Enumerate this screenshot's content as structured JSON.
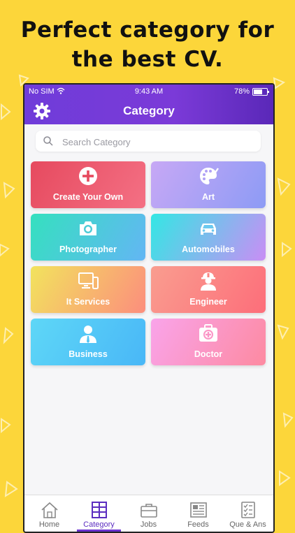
{
  "promo": {
    "line1": "Perfect category for",
    "line2": "the best CV."
  },
  "status_bar": {
    "carrier": "No SIM",
    "time": "9:43 AM",
    "battery": "78%",
    "battery_level": 0.78
  },
  "header": {
    "title": "Category",
    "settings_icon": "gear-icon"
  },
  "search": {
    "placeholder": "Search Category",
    "value": ""
  },
  "categories": [
    {
      "label": "Create Your Own",
      "icon": "plus-circle-icon",
      "colors": [
        "#e64a5f",
        "#f47084"
      ]
    },
    {
      "label": "Art",
      "icon": "palette-icon",
      "colors": [
        "#c7a8f5",
        "#8d9bf5"
      ]
    },
    {
      "label": "Photographer",
      "icon": "camera-icon",
      "colors": [
        "#35e0bf",
        "#63b6f4"
      ]
    },
    {
      "label": "Automobiles",
      "icon": "car-icon",
      "colors": [
        "#33e7e4",
        "#c98ef5"
      ]
    },
    {
      "label": "It Services",
      "icon": "computer-icon",
      "colors": [
        "#f2e35d",
        "#fc8e7d"
      ]
    },
    {
      "label": "Engineer",
      "icon": "engineer-icon",
      "colors": [
        "#f99d8f",
        "#fd6e7a"
      ]
    },
    {
      "label": "Business",
      "icon": "businessman-icon",
      "colors": [
        "#5ed7f7",
        "#49b7f7"
      ]
    },
    {
      "label": "Doctor",
      "icon": "medical-kit-icon",
      "colors": [
        "#f9a4ea",
        "#fd8aa1"
      ]
    }
  ],
  "tabs": [
    {
      "label": "Home",
      "icon": "home-icon"
    },
    {
      "label": "Category",
      "icon": "category-grid-icon",
      "active": true
    },
    {
      "label": "Jobs",
      "icon": "briefcase-icon"
    },
    {
      "label": "Feeds",
      "icon": "newspaper-icon"
    },
    {
      "label": "Que & Ans",
      "icon": "checklist-icon"
    }
  ],
  "colors": {
    "background": "#fcd63a",
    "header_start": "#6f3cd9",
    "header_end": "#5a28b8",
    "active_tab": "#6a32d0"
  }
}
